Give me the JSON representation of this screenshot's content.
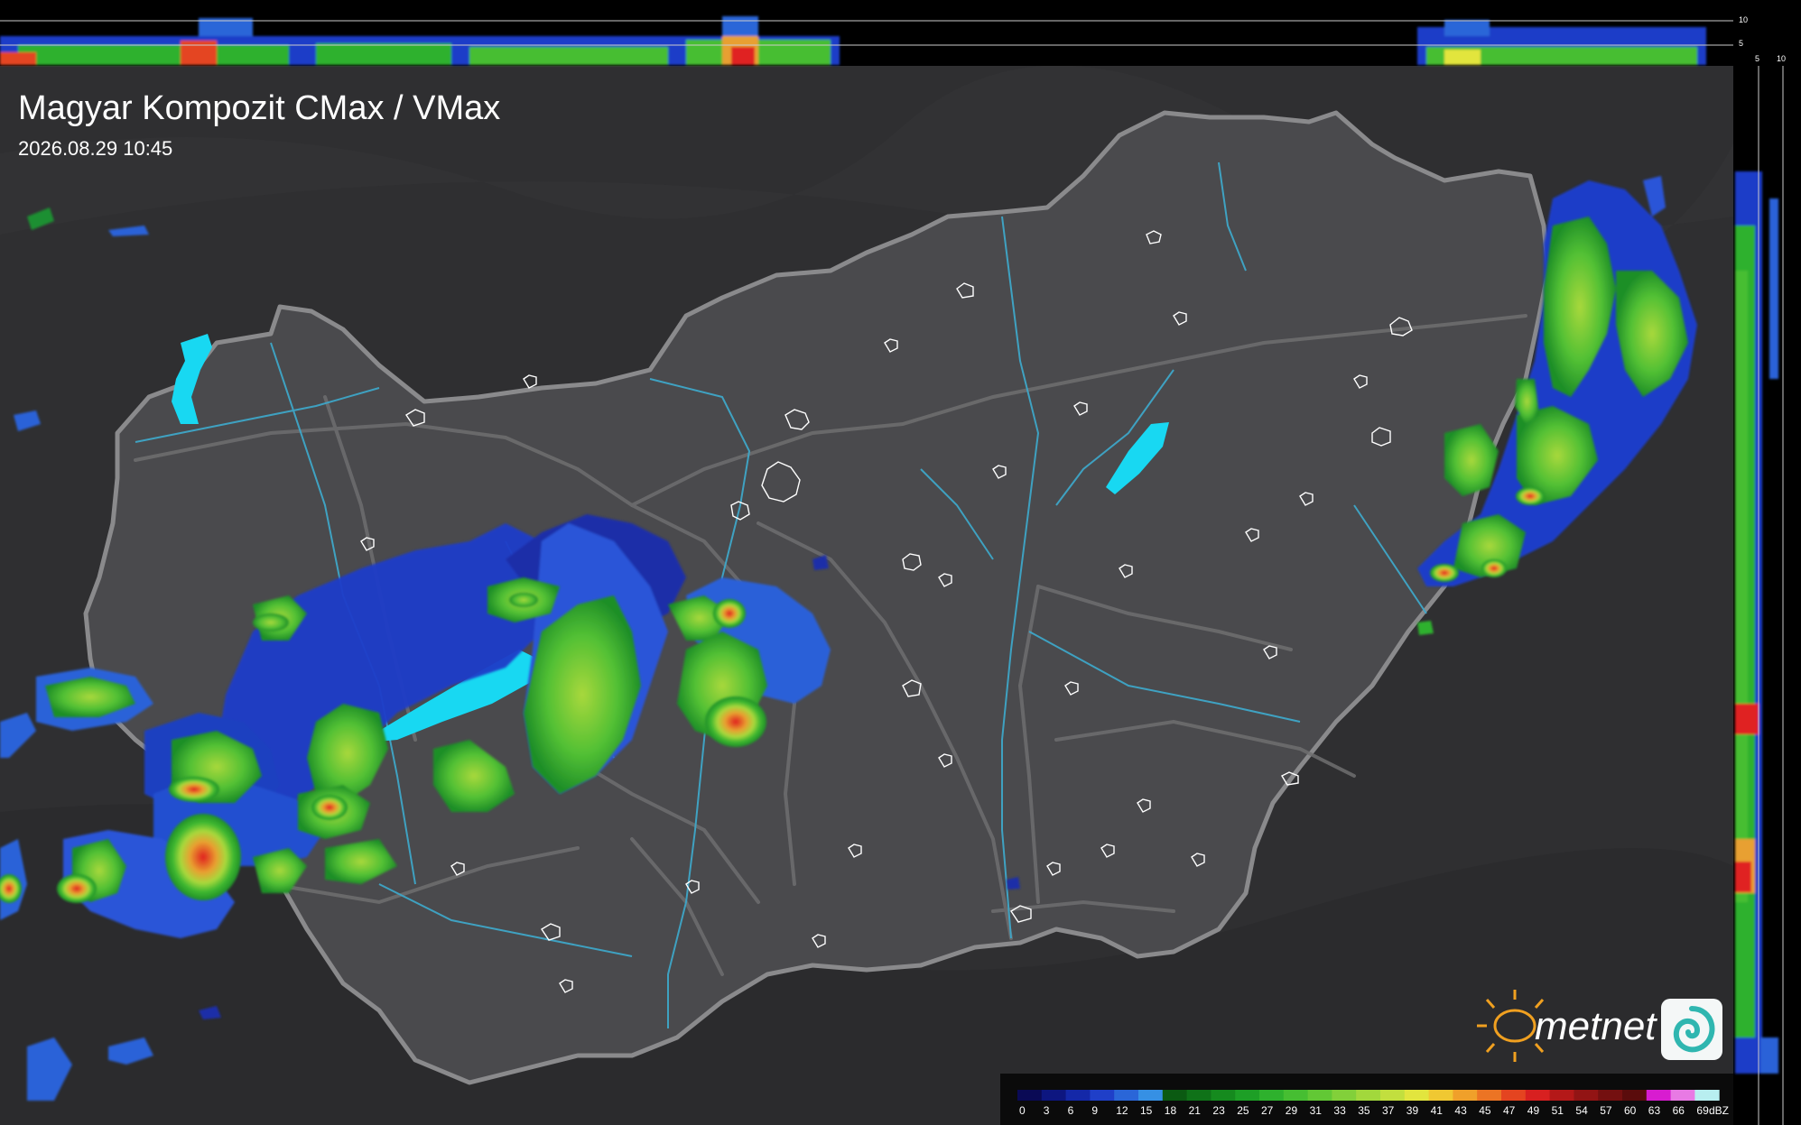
{
  "title": "Magyar Kompozit CMax / VMax",
  "timestamp": "2026.08.29 10:45",
  "brand": {
    "name": "metnet",
    "sun_color": "#f0a020",
    "icon_bg": "#f4f7f7",
    "icon_swirl": "#2fb6b0"
  },
  "colors": {
    "background": "#2f2f31",
    "country_fill": "#4a4a4d",
    "border": "#8a8a8c",
    "rivers": "#3ea6c8",
    "lakes": "#18d8f2",
    "cities": "#ffffff",
    "profile_bg": "#000000",
    "scale_bg": "#0b0b0b"
  },
  "profile_top": {
    "labels": [
      "10",
      "5"
    ]
  },
  "profile_right": {
    "labels": [
      "5",
      "10"
    ]
  },
  "color_scale": {
    "unit": "dBZ",
    "labels": [
      "0",
      "3",
      "6",
      "9",
      "12",
      "15",
      "18",
      "21",
      "23",
      "25",
      "27",
      "29",
      "31",
      "33",
      "35",
      "37",
      "39",
      "41",
      "43",
      "45",
      "47",
      "49",
      "51",
      "54",
      "57",
      "60",
      "63",
      "66",
      "69"
    ],
    "colors": [
      "#0a0a55",
      "#0d1680",
      "#1428a8",
      "#1f3fc8",
      "#2a66d8",
      "#3690e4",
      "#0b5a12",
      "#0f7218",
      "#158a1e",
      "#1d9f26",
      "#2eb12d",
      "#46be32",
      "#62c835",
      "#82d03a",
      "#a2d83c",
      "#c2df3e",
      "#e2e53e",
      "#f0c832",
      "#f0a02a",
      "#ec7424",
      "#e44420",
      "#d82020",
      "#b41818",
      "#921414",
      "#741010",
      "#5a0c0c",
      "#d81cd0",
      "#e87ae4",
      "#b8eef0"
    ]
  }
}
